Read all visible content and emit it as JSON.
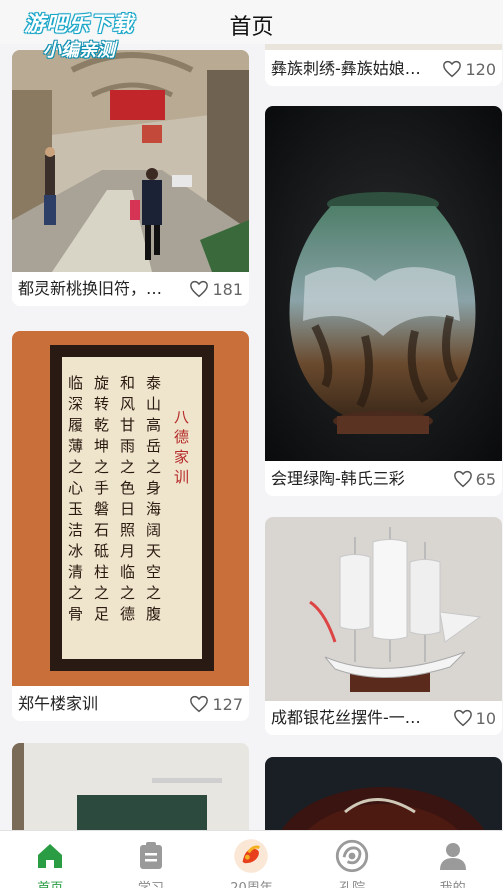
{
  "watermark": {
    "line1": "游吧乐下载",
    "line2": "小编亲测"
  },
  "header": {
    "title": "首页"
  },
  "cards": [
    {
      "title": "彝族刺绣-彝族姑娘…",
      "likes": "120"
    },
    {
      "title": "都灵新桃换旧符，…",
      "likes": "181"
    },
    {
      "title": "会理绿陶-韩氏三彩",
      "likes": "65"
    },
    {
      "title": "郑午楼家训",
      "likes": "127"
    },
    {
      "title": "成都银花丝摆件-一…",
      "likes": "10"
    }
  ],
  "scroll_art": {
    "heading": "八德家训",
    "columns": [
      "泰山高岳之身海阔天空之腹",
      "和风甘雨之色日照月临之德",
      "旋转乾坤之手磐石砥柱之足",
      "临深履薄之心玉洁冰清之骨"
    ]
  },
  "tabbar": {
    "tabs": [
      {
        "label": "首页",
        "icon": "home-icon",
        "active": true
      },
      {
        "label": "学习",
        "icon": "clipboard-icon",
        "active": false
      },
      {
        "label": "20周年",
        "icon": "anniversary-logo-icon",
        "active": false
      },
      {
        "label": "孔院",
        "icon": "confucius-institute-icon",
        "active": false
      },
      {
        "label": "我的",
        "icon": "user-icon",
        "active": false
      }
    ]
  },
  "colors": {
    "accent": "#2a9d44",
    "inactive": "#888888"
  }
}
